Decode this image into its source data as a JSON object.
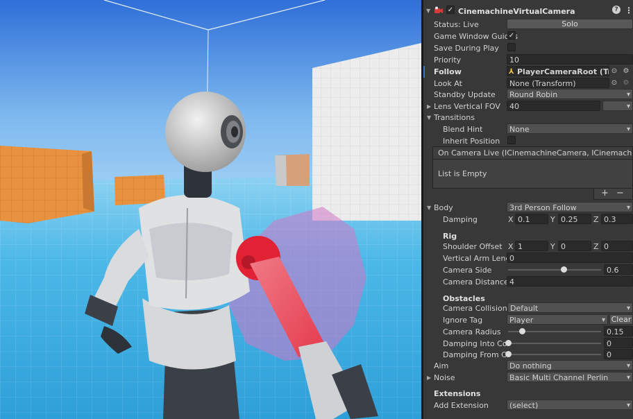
{
  "component": {
    "title": "CinemachineVirtualCamera",
    "enabled_check": "✓",
    "help_icon": "question-icon",
    "menu_icon": "kebab-menu-icon"
  },
  "fields": {
    "status": {
      "label": "Status: Live",
      "button": "Solo"
    },
    "game_window_guides": {
      "label": "Game Window Guides",
      "check": "✓"
    },
    "save_during_play": {
      "label": "Save During Play"
    },
    "priority": {
      "label": "Priority",
      "value": "10"
    },
    "follow": {
      "label": "Follow",
      "value": "PlayerCameraRoot (Transfo"
    },
    "look_at": {
      "label": "Look At",
      "value": "None (Transform)"
    },
    "standby_update": {
      "label": "Standby Update",
      "value": "Round Robin"
    },
    "lens": {
      "label": "Lens Vertical FOV",
      "value": "40"
    },
    "transitions": {
      "label": "Transitions"
    },
    "blend_hint": {
      "label": "Blend Hint",
      "value": "None"
    },
    "inherit_position": {
      "label": "Inherit Position"
    },
    "event": {
      "header": "On Camera Live (ICinemachineCamera, ICinemachineCame",
      "empty": "List is Empty",
      "add": "+",
      "remove": "−"
    },
    "body": {
      "label": "Body",
      "value": "3rd Person Follow"
    },
    "damping": {
      "label": "Damping",
      "x": "0.1",
      "y": "0.25",
      "z": "0.3"
    },
    "rig": {
      "label": "Rig"
    },
    "shoulder_offset": {
      "label": "Shoulder Offset",
      "x": "1",
      "y": "0",
      "z": "0"
    },
    "vertical_arm": {
      "label": "Vertical Arm Length",
      "value": "0"
    },
    "camera_side": {
      "label": "Camera Side",
      "value": "0.6",
      "fraction": 0.6
    },
    "camera_distance": {
      "label": "Camera Distance",
      "value": "4"
    },
    "obstacles": {
      "label": "Obstacles"
    },
    "collision_filter": {
      "label": "Camera Collision Fil",
      "value": "Default"
    },
    "ignore_tag": {
      "label": "Ignore Tag",
      "value": "Player",
      "button": "Clear"
    },
    "camera_radius": {
      "label": "Camera Radius",
      "value": "0.15",
      "fraction": 0.15
    },
    "damping_into": {
      "label": "Damping Into Collisi",
      "value": "0",
      "fraction": 0
    },
    "damping_from": {
      "label": "Damping From Collis",
      "value": "0",
      "fraction": 0
    },
    "aim": {
      "label": "Aim",
      "value": "Do nothing"
    },
    "noise": {
      "label": "Noise",
      "value": "Basic Multi Channel Perlin"
    },
    "extensions": {
      "label": "Extensions"
    },
    "add_extension": {
      "label": "Add Extension",
      "value": "(select)"
    }
  },
  "axes": {
    "x": "X",
    "y": "Y",
    "z": "Z"
  },
  "colors": {
    "sky_top": "#2f6fd8",
    "sky_bottom": "#9fd0f3",
    "ground": "#3fb1e5",
    "accent_blue": "#3a79bb",
    "cube_orange": "#e8913f",
    "arm_red": "#e1283a"
  }
}
